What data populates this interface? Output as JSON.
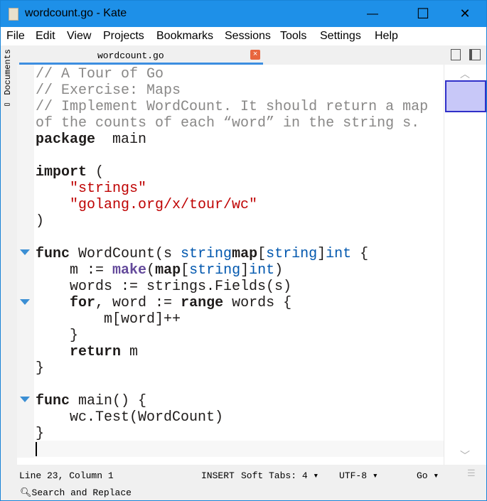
{
  "window": {
    "title": "wordcount.go  - Kate",
    "minimize": "—",
    "maximize": "☐",
    "close": "✕"
  },
  "menu": [
    "File",
    "Edit",
    "View",
    "Projects",
    "Bookmarks",
    "Sessions",
    "Tools",
    "Settings",
    "Help"
  ],
  "sidebar": {
    "documents_label": "Documents"
  },
  "tab": {
    "label": "wordcount.go",
    "close": "×"
  },
  "code": [
    [
      [
        "cmt",
        "// A Tour of Go"
      ]
    ],
    [
      [
        "cmt",
        "// Exercise: Maps"
      ]
    ],
    [
      [
        "cmt",
        "// Implement WordCount. It should return a map"
      ]
    ],
    [
      [
        "cmt",
        "of the counts of each “word” in the string s."
      ]
    ],
    [
      [
        "kw",
        "package"
      ],
      [
        "",
        "  main"
      ]
    ],
    [],
    [
      [
        "kw",
        "import"
      ],
      [
        "",
        " ("
      ]
    ],
    [
      [
        "",
        "    "
      ],
      [
        "str",
        "\"strings\""
      ]
    ],
    [
      [
        "",
        "    "
      ],
      [
        "str",
        "\"golang.org/x/tour/wc\""
      ]
    ],
    [
      [
        "",
        ")"
      ]
    ],
    [],
    [
      [
        "kw",
        "func"
      ],
      [
        "",
        " WordCount(s "
      ],
      [
        "typ",
        "string"
      ],
      [
        ") "
      ],
      [
        "kw",
        "map"
      ],
      [
        "",
        "["
      ],
      [
        "typ",
        "string"
      ],
      [
        "",
        "]"
      ],
      [
        "typ",
        "int"
      ],
      [
        "",
        " {"
      ]
    ],
    [
      [
        "",
        "    m := "
      ],
      [
        "bi",
        "make"
      ],
      [
        "",
        "("
      ],
      [
        "kw",
        "map"
      ],
      [
        "",
        "["
      ],
      [
        "typ",
        "string"
      ],
      [
        "",
        "]"
      ],
      [
        "typ",
        "int"
      ],
      [
        "",
        ")"
      ]
    ],
    [
      [
        "",
        "    words := strings.Fields(s)"
      ]
    ],
    [
      [
        "",
        "    "
      ],
      [
        "kw",
        "for"
      ],
      [
        "",
        ", word := "
      ],
      [
        "kw",
        "range"
      ],
      [
        "",
        " words {"
      ]
    ],
    [
      [
        "",
        "        m[word]++"
      ]
    ],
    [
      [
        "",
        "    }"
      ]
    ],
    [
      [
        "",
        "    "
      ],
      [
        "kw",
        "return"
      ],
      [
        "",
        " m"
      ]
    ],
    [
      [
        "",
        "}"
      ]
    ],
    [],
    [
      [
        "kw",
        "func"
      ],
      [
        "",
        " main() {"
      ]
    ],
    [
      [
        "",
        "    wc.Test(WordCount)"
      ]
    ],
    [
      [
        "",
        "}"
      ]
    ],
    []
  ],
  "status": {
    "position": "Line 23, Column 1",
    "mode": "INSERT",
    "tabs": "Soft Tabs: 4",
    "encoding": "UTF-8",
    "language": "Go",
    "search": "Search and Replace"
  }
}
